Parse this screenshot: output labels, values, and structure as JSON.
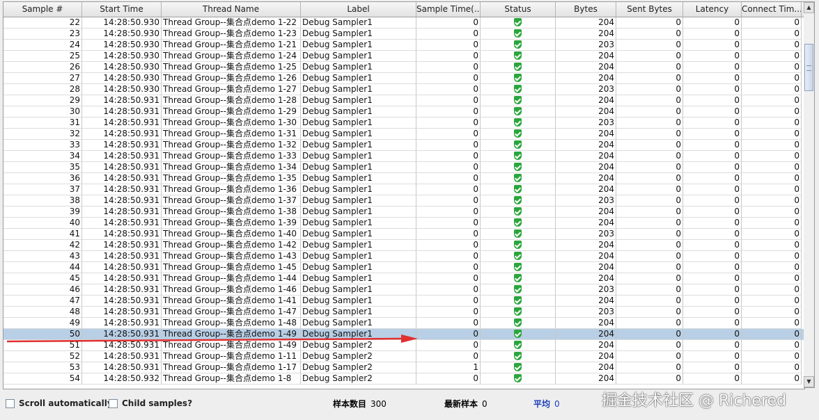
{
  "columns": [
    "Sample #",
    "Start Time",
    "Thread Name",
    "Label",
    "Sample Time(...",
    "Status",
    "Bytes",
    "Sent Bytes",
    "Latency",
    "Connect Tim..."
  ],
  "rows": [
    [
      "22",
      "14:28:50.930",
      "Thread Group--集合点demo 1-22",
      "Debug Sampler1",
      "0",
      "ok",
      "204",
      "0",
      "0",
      "0"
    ],
    [
      "23",
      "14:28:50.930",
      "Thread Group--集合点demo 1-23",
      "Debug Sampler1",
      "0",
      "ok",
      "204",
      "0",
      "0",
      "0"
    ],
    [
      "24",
      "14:28:50.930",
      "Thread Group--集合点demo 1-21",
      "Debug Sampler1",
      "0",
      "ok",
      "203",
      "0",
      "0",
      "0"
    ],
    [
      "25",
      "14:28:50.930",
      "Thread Group--集合点demo 1-24",
      "Debug Sampler1",
      "0",
      "ok",
      "204",
      "0",
      "0",
      "0"
    ],
    [
      "26",
      "14:28:50.930",
      "Thread Group--集合点demo 1-25",
      "Debug Sampler1",
      "0",
      "ok",
      "204",
      "0",
      "0",
      "0"
    ],
    [
      "27",
      "14:28:50.930",
      "Thread Group--集合点demo 1-26",
      "Debug Sampler1",
      "0",
      "ok",
      "204",
      "0",
      "0",
      "0"
    ],
    [
      "28",
      "14:28:50.930",
      "Thread Group--集合点demo 1-27",
      "Debug Sampler1",
      "0",
      "ok",
      "203",
      "0",
      "0",
      "0"
    ],
    [
      "29",
      "14:28:50.931",
      "Thread Group--集合点demo 1-28",
      "Debug Sampler1",
      "0",
      "ok",
      "204",
      "0",
      "0",
      "0"
    ],
    [
      "30",
      "14:28:50.931",
      "Thread Group--集合点demo 1-29",
      "Debug Sampler1",
      "0",
      "ok",
      "204",
      "0",
      "0",
      "0"
    ],
    [
      "31",
      "14:28:50.931",
      "Thread Group--集合点demo 1-30",
      "Debug Sampler1",
      "0",
      "ok",
      "203",
      "0",
      "0",
      "0"
    ],
    [
      "32",
      "14:28:50.931",
      "Thread Group--集合点demo 1-31",
      "Debug Sampler1",
      "0",
      "ok",
      "204",
      "0",
      "0",
      "0"
    ],
    [
      "33",
      "14:28:50.931",
      "Thread Group--集合点demo 1-32",
      "Debug Sampler1",
      "0",
      "ok",
      "204",
      "0",
      "0",
      "0"
    ],
    [
      "34",
      "14:28:50.931",
      "Thread Group--集合点demo 1-33",
      "Debug Sampler1",
      "0",
      "ok",
      "204",
      "0",
      "0",
      "0"
    ],
    [
      "35",
      "14:28:50.931",
      "Thread Group--集合点demo 1-34",
      "Debug Sampler1",
      "0",
      "ok",
      "204",
      "0",
      "0",
      "0"
    ],
    [
      "36",
      "14:28:50.931",
      "Thread Group--集合点demo 1-35",
      "Debug Sampler1",
      "0",
      "ok",
      "204",
      "0",
      "0",
      "0"
    ],
    [
      "37",
      "14:28:50.931",
      "Thread Group--集合点demo 1-36",
      "Debug Sampler1",
      "0",
      "ok",
      "204",
      "0",
      "0",
      "0"
    ],
    [
      "38",
      "14:28:50.931",
      "Thread Group--集合点demo 1-37",
      "Debug Sampler1",
      "0",
      "ok",
      "203",
      "0",
      "0",
      "0"
    ],
    [
      "39",
      "14:28:50.931",
      "Thread Group--集合点demo 1-38",
      "Debug Sampler1",
      "0",
      "ok",
      "204",
      "0",
      "0",
      "0"
    ],
    [
      "40",
      "14:28:50.931",
      "Thread Group--集合点demo 1-39",
      "Debug Sampler1",
      "0",
      "ok",
      "204",
      "0",
      "0",
      "0"
    ],
    [
      "41",
      "14:28:50.931",
      "Thread Group--集合点demo 1-40",
      "Debug Sampler1",
      "0",
      "ok",
      "203",
      "0",
      "0",
      "0"
    ],
    [
      "42",
      "14:28:50.931",
      "Thread Group--集合点demo 1-42",
      "Debug Sampler1",
      "0",
      "ok",
      "204",
      "0",
      "0",
      "0"
    ],
    [
      "43",
      "14:28:50.931",
      "Thread Group--集合点demo 1-43",
      "Debug Sampler1",
      "0",
      "ok",
      "204",
      "0",
      "0",
      "0"
    ],
    [
      "44",
      "14:28:50.931",
      "Thread Group--集合点demo 1-45",
      "Debug Sampler1",
      "0",
      "ok",
      "204",
      "0",
      "0",
      "0"
    ],
    [
      "45",
      "14:28:50.931",
      "Thread Group--集合点demo 1-44",
      "Debug Sampler1",
      "0",
      "ok",
      "204",
      "0",
      "0",
      "0"
    ],
    [
      "46",
      "14:28:50.931",
      "Thread Group--集合点demo 1-46",
      "Debug Sampler1",
      "0",
      "ok",
      "203",
      "0",
      "0",
      "0"
    ],
    [
      "47",
      "14:28:50.931",
      "Thread Group--集合点demo 1-41",
      "Debug Sampler1",
      "0",
      "ok",
      "204",
      "0",
      "0",
      "0"
    ],
    [
      "48",
      "14:28:50.931",
      "Thread Group--集合点demo 1-47",
      "Debug Sampler1",
      "0",
      "ok",
      "203",
      "0",
      "0",
      "0"
    ],
    [
      "49",
      "14:28:50.931",
      "Thread Group--集合点demo 1-48",
      "Debug Sampler1",
      "0",
      "ok",
      "204",
      "0",
      "0",
      "0"
    ],
    [
      "50",
      "14:28:50.931",
      "Thread Group--集合点demo 1-49",
      "Debug Sampler1",
      "0",
      "ok",
      "204",
      "0",
      "0",
      "0"
    ],
    [
      "51",
      "14:28:50.931",
      "Thread Group--集合点demo 1-49",
      "Debug Sampler2",
      "0",
      "ok",
      "204",
      "0",
      "0",
      "0"
    ],
    [
      "52",
      "14:28:50.931",
      "Thread Group--集合点demo 1-11",
      "Debug Sampler2",
      "0",
      "ok",
      "204",
      "0",
      "0",
      "0"
    ],
    [
      "53",
      "14:28:50.931",
      "Thread Group--集合点demo 1-17",
      "Debug Sampler2",
      "1",
      "ok",
      "204",
      "0",
      "0",
      "0"
    ],
    [
      "54",
      "14:28:50.932",
      "Thread Group--集合点demo 1-8",
      "Debug Sampler2",
      "0",
      "ok",
      "204",
      "0",
      "0",
      "0"
    ]
  ],
  "selected_sample": "50",
  "status_icon": "success-shield-icon",
  "colors": {
    "selection": "#b8cfe5",
    "arrow": "#e03030",
    "status_ok": "#2aa63b",
    "avg_value": "#1f3fb8"
  },
  "bottom": {
    "scroll_auto_label": "Scroll automatically?",
    "child_samples_label": "Child samples?",
    "sample_count_label": "样本数目",
    "sample_count_value": "300",
    "latest_label": "最新样本",
    "latest_value": "0",
    "avg_label": "平均",
    "avg_value": "0"
  },
  "watermark": "掘金技术社区 @ Richered"
}
